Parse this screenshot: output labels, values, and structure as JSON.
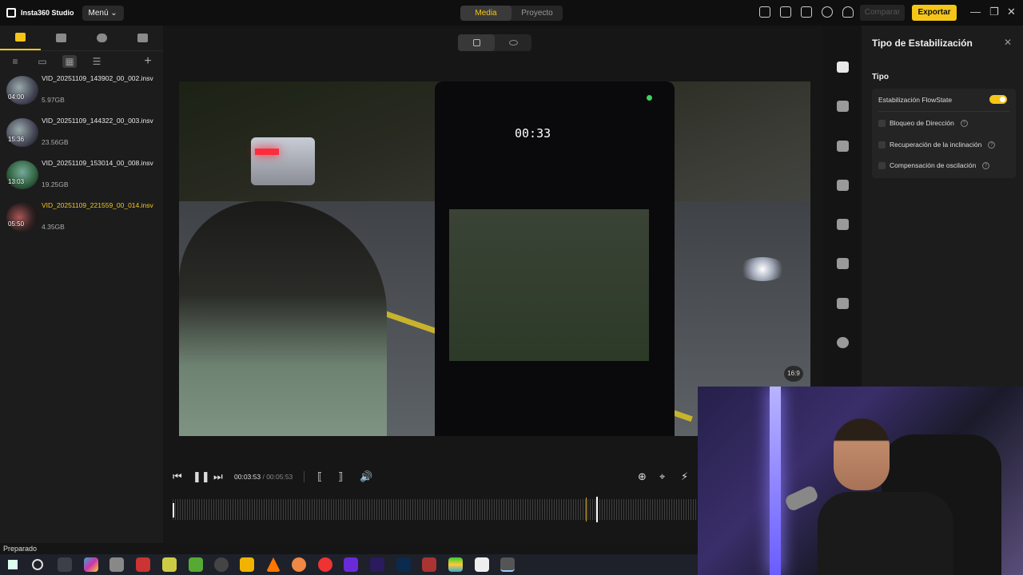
{
  "app": {
    "title": "Insta360 Studio",
    "menu_label": "Menú"
  },
  "modes": [
    {
      "label": "Media"
    },
    {
      "label": "Proyecto"
    }
  ],
  "header_buttons": {
    "compare": "Comparar",
    "export": "Exportar"
  },
  "window_controls": {
    "minimize": "—",
    "maximize": "❐",
    "close": "✕"
  },
  "files": [
    {
      "name": "VID_20251109_143902_00_002.insv",
      "duration": "04:00",
      "size": "5.97GB",
      "selected": false
    },
    {
      "name": "VID_20251109_144322_00_003.insv",
      "duration": "15:36",
      "size": "23.56GB",
      "selected": false
    },
    {
      "name": "VID_20251109_153014_00_008.insv",
      "duration": "13:03",
      "size": "19.25GB",
      "selected": false
    },
    {
      "name": "VID_20251109_221559_00_014.insv",
      "duration": "05:50",
      "size": "4.35GB",
      "selected": true
    }
  ],
  "video": {
    "overlay_timer": "00:33",
    "aspect": "16:9"
  },
  "playback": {
    "current": "00:03:53",
    "total": "/ 00:05:53"
  },
  "stabilization": {
    "title": "Tipo de Estabilización",
    "section": "Tipo",
    "flowstate_label": "Estabilización FlowState",
    "flowstate_on": true,
    "options": [
      {
        "label": "Bloqueo de Dirección"
      },
      {
        "label": "Recuperación de la inclinación"
      },
      {
        "label": "Compensación de oscilación"
      }
    ]
  },
  "status": "Preparado",
  "colors": {
    "accent": "#f5c518",
    "panel": "#1c1c1c",
    "background": "#151515"
  }
}
